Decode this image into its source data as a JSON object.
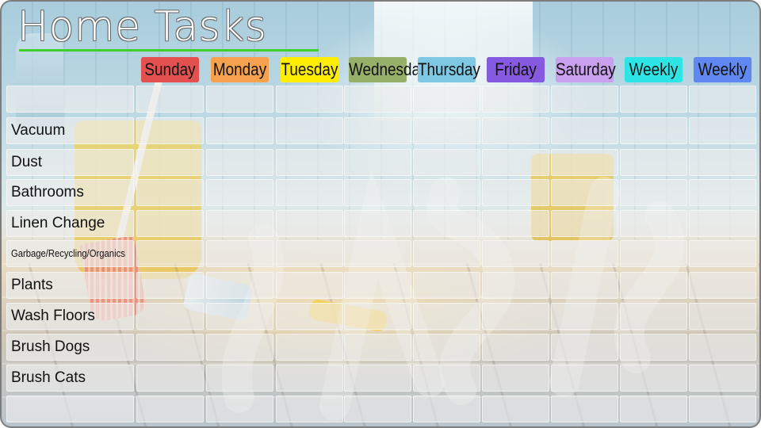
{
  "title": "Home Tasks",
  "days": [
    {
      "label": "Sunday",
      "color": "#e35050"
    },
    {
      "label": "Monday",
      "color": "#f6a14d"
    },
    {
      "label": "Tuesday",
      "color": "#ffee00"
    },
    {
      "label": "Wednesday",
      "color": "#96b06a"
    },
    {
      "label": "Thursday",
      "color": "#7ec8e3"
    },
    {
      "label": "Friday",
      "color": "#8559e0"
    },
    {
      "label": "Saturday",
      "color": "#c9a0f0"
    },
    {
      "label": "Weekly",
      "color": "#2de5e5"
    },
    {
      "label": "Weekly",
      "color": "#5f88f2"
    }
  ],
  "tasks": [
    "",
    "Vacuum",
    "Dust",
    "Bathrooms",
    "Linen Change",
    "Garbage/Recycling/Organics",
    "Plants",
    "Wash Floors",
    "Brush Dogs",
    "Brush Cats",
    ""
  ]
}
